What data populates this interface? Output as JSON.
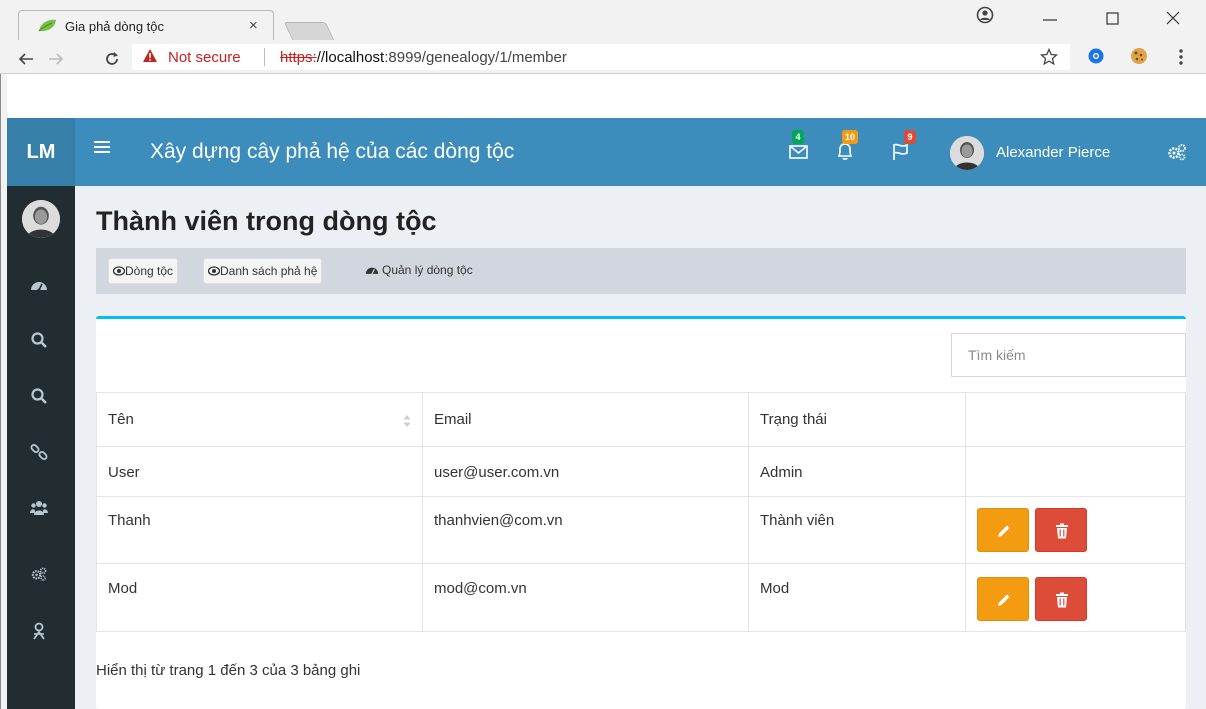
{
  "browser": {
    "tab_title": "Gia phả dòng tộc",
    "close_glyph": "×",
    "security_label": "Not secure",
    "url_scheme": "https:",
    "url_host": "//localhost",
    "url_rest": ":8999/genealogy/1/member"
  },
  "header": {
    "logo": "LM",
    "title": "Xây dựng cây phả hệ của các dòng tộc",
    "messages_count": "4",
    "notifications_count": "10",
    "tasks_count": "9",
    "user_name": "Alexander Pierce"
  },
  "sidebar": {
    "icons": [
      "dashboard-icon",
      "search-icon",
      "search-icon",
      "link-icon",
      "users-icon",
      "cogs-icon",
      "user-tie-icon"
    ]
  },
  "page": {
    "title": "Thành viên trong dòng tộc",
    "breadcrumb": {
      "item1": "Dòng tộc",
      "item2": "Danh sách phả hệ",
      "item3": "Quản lý dòng tộc"
    },
    "search_placeholder": "Tìm kiếm"
  },
  "table": {
    "columns": [
      "Tên",
      "Email",
      "Trạng thái",
      ""
    ],
    "rows": [
      {
        "name": "User",
        "email": "user@user.com.vn",
        "status": "Admin",
        "actions": false
      },
      {
        "name": "Thanh",
        "email": "thanhvien@com.vn",
        "status": "Thành viên",
        "actions": true
      },
      {
        "name": "Mod",
        "email": "mod@com.vn",
        "status": "Mod",
        "actions": true
      }
    ]
  },
  "footer": {
    "info": "Hiển thị từ trang 1 đến 3 của 3 bảng ghi"
  },
  "colors": {
    "header": "#3c8dbc",
    "sidebar": "#222d32",
    "box_top": "#00c0ef",
    "edit": "#f39c12",
    "delete": "#dd4b39"
  }
}
